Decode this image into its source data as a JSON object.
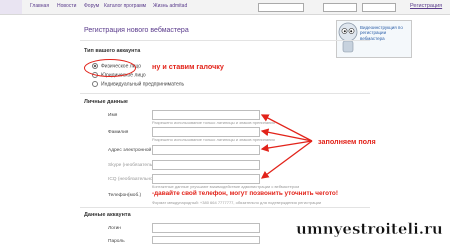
{
  "topbar": {
    "nav": [
      "Главная",
      "Новости",
      "Форум",
      "Каталог программ",
      "Жизнь admitad"
    ],
    "register_link": "Регистрация"
  },
  "title": "Регистрация нового вебмастера",
  "promo": {
    "text": "Видеоинструкция по регистрации вебмастера"
  },
  "account_type": {
    "section_label": "Тип вашего аккаунта",
    "options": [
      "Физическое лицо",
      "Юридическое лицо",
      "Индивидуальный предприниматель"
    ],
    "selected_index": 0
  },
  "personal": {
    "section_label": "Личные данные",
    "fields": [
      {
        "label": "Имя",
        "hint": "Разрешено использование только латиницы и знаков препинания"
      },
      {
        "label": "Фамилия",
        "hint": "Разрешено использование только латиницы и знаков препинания"
      },
      {
        "label": "Адрес электронной почты",
        "hint": ""
      },
      {
        "label": "Skype (необязательно)",
        "hint": ""
      },
      {
        "label": "ICQ (необязательно)",
        "hint": "Контактные данные улучшают взаимодействие администрации с вебмастером"
      },
      {
        "label": "Телефон(моб.)",
        "hint": "Формат международный: +380 664 7777777, обязательно для подтверждения регистрации"
      }
    ]
  },
  "account_data": {
    "section_label": "Данные аккаунта",
    "fields": [
      {
        "label": "Логин"
      },
      {
        "label": "Пароль"
      }
    ]
  },
  "annotations": {
    "radio_note": "ну и ставим галочку",
    "fields_note": "заполняем поля",
    "phone_note": "-давайте свой телефон, могут позвонить уточнить чегото!"
  },
  "watermark": "umnyestroiteli.ru",
  "colors": {
    "accent": "#5a3b8c",
    "annotation_red": "#e2231a"
  }
}
